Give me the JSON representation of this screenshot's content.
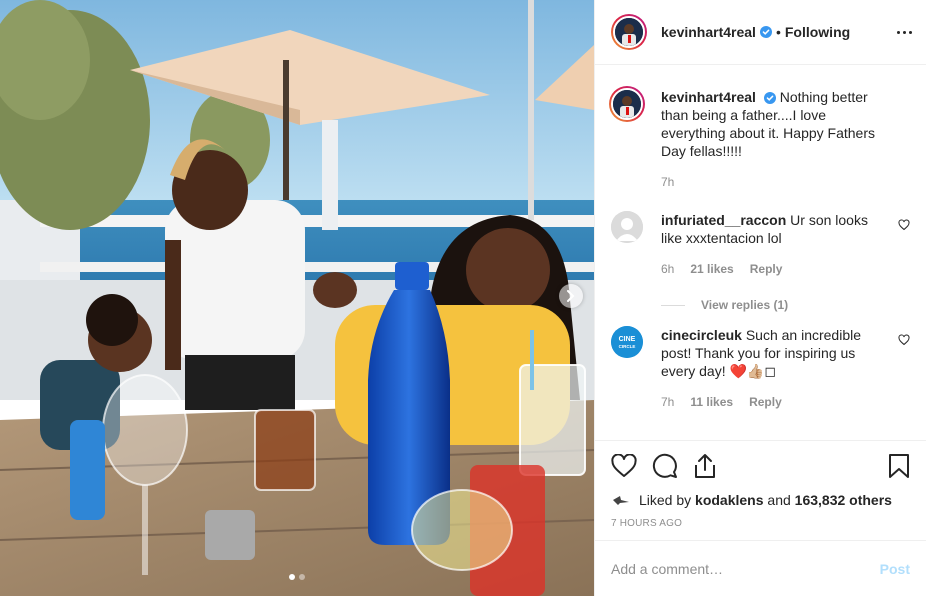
{
  "post": {
    "author": "kevinhart4real",
    "separator": "•",
    "following_label": "Following",
    "photo_alt": "Family at a seaside restaurant table"
  },
  "caption": {
    "author": "kevinhart4real",
    "text": "Nothing better than being a father....I love everything about it. Happy Fathers Day fellas!!!!!",
    "time": "7h"
  },
  "comments": [
    {
      "author": "infuriated__raccon",
      "text": "Ur son looks like xxxtentacion lol",
      "time": "6h",
      "likes": "21 likes",
      "reply": "Reply"
    },
    {
      "author": "cinecircleuk",
      "text": "Such an incredible post! Thank you for inspiring us every day! ❤️👍🏼◻",
      "time": "7h",
      "likes": "11 likes",
      "reply": "Reply",
      "avatar_text_top": "CINE",
      "avatar_text_bottom": "CIRCLE"
    }
  ],
  "view_replies": "View replies (1)",
  "likes": {
    "prefix": "Liked by ",
    "user": "kodaklens",
    "middle": " and ",
    "count": "163,832 others"
  },
  "posted_ago": "7 HOURS AGO",
  "add_comment": {
    "placeholder": "Add a comment…",
    "post_label": "Post"
  },
  "colors": {
    "accent": "#3897f0",
    "post_disabled": "#b2dffc",
    "muted": "#8e8e8e",
    "border": "#efefef"
  },
  "icons": [
    "verified-badge-icon",
    "more-options-icon",
    "like-heart-icon",
    "comment-icon",
    "share-icon",
    "bookmark-icon",
    "chevron-right-icon"
  ]
}
